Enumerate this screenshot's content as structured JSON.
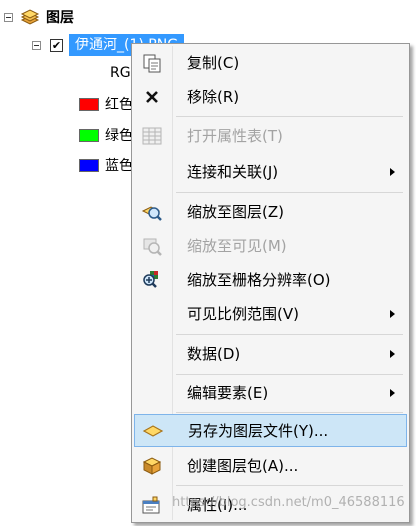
{
  "toc": {
    "group_label": "图层",
    "layer_name": "伊通河_(1).PNG",
    "band_label_partial": "RG",
    "legend": [
      {
        "label": "红色",
        "color": "#ff0000"
      },
      {
        "label": "绿色",
        "color": "#00ff00"
      },
      {
        "label": "蓝色",
        "color": "#0000ff"
      }
    ],
    "layer_checked": "✔"
  },
  "menu": {
    "items": [
      {
        "label": "复制(C)",
        "icon": "copy-icon",
        "enabled": true
      },
      {
        "label": "移除(R)",
        "icon": "remove-icon",
        "enabled": true
      },
      {
        "label": "打开属性表(T)",
        "icon": "table-icon",
        "enabled": false
      },
      {
        "label": "连接和关联(J)",
        "icon": "",
        "enabled": true,
        "submenu": true
      },
      {
        "label": "缩放至图层(Z)",
        "icon": "zoom-to-layer-icon",
        "enabled": true
      },
      {
        "label": "缩放至可见(M)",
        "icon": "zoom-to-visible-icon",
        "enabled": false
      },
      {
        "label": "缩放至栅格分辨率(O)",
        "icon": "zoom-to-raster-resolution-icon",
        "enabled": true
      },
      {
        "label": "可见比例范围(V)",
        "icon": "",
        "enabled": true,
        "submenu": true
      },
      {
        "label": "数据(D)",
        "icon": "",
        "enabled": true,
        "submenu": true
      },
      {
        "label": "编辑要素(E)",
        "icon": "",
        "enabled": true,
        "submenu": true
      },
      {
        "label": "另存为图层文件(Y)...",
        "icon": "save-layer-file-icon",
        "enabled": true,
        "highlighted": true
      },
      {
        "label": "创建图层包(A)...",
        "icon": "create-layer-package-icon",
        "enabled": true
      },
      {
        "label": "属性(I)...",
        "icon": "properties-icon",
        "enabled": true
      }
    ]
  },
  "watermark": "https://blog.csdn.net/m0_46588116",
  "colors": {
    "selection": "#3399ff",
    "menu_bg": "#f5f5f5",
    "highlight_bg": "#cde6f7",
    "highlight_border": "#7eb4ea",
    "disabled_text": "#a3a3a3"
  }
}
